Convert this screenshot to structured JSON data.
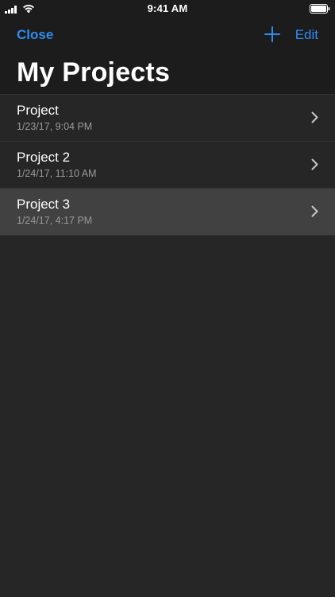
{
  "status_bar": {
    "time": "9:41 AM",
    "icons": [
      "signal-icon",
      "wifi-icon",
      "battery-icon"
    ]
  },
  "navigation": {
    "close_label": "Close",
    "add_icon": "plus-icon",
    "edit_label": "Edit",
    "title": "My Projects"
  },
  "projects": [
    {
      "name": "Project",
      "date": "1/23/17, 9:04 PM",
      "selected": false
    },
    {
      "name": "Project 2",
      "date": "1/24/17, 11:10 AM",
      "selected": false
    },
    {
      "name": "Project 3",
      "date": "1/24/17, 4:17 PM",
      "selected": true
    }
  ],
  "colors": {
    "accent": "#2f8cf0",
    "background": "#262626",
    "bar_background": "#1c1c1c",
    "selected_row": "#414141",
    "secondary_text": "#9a9a9a"
  }
}
